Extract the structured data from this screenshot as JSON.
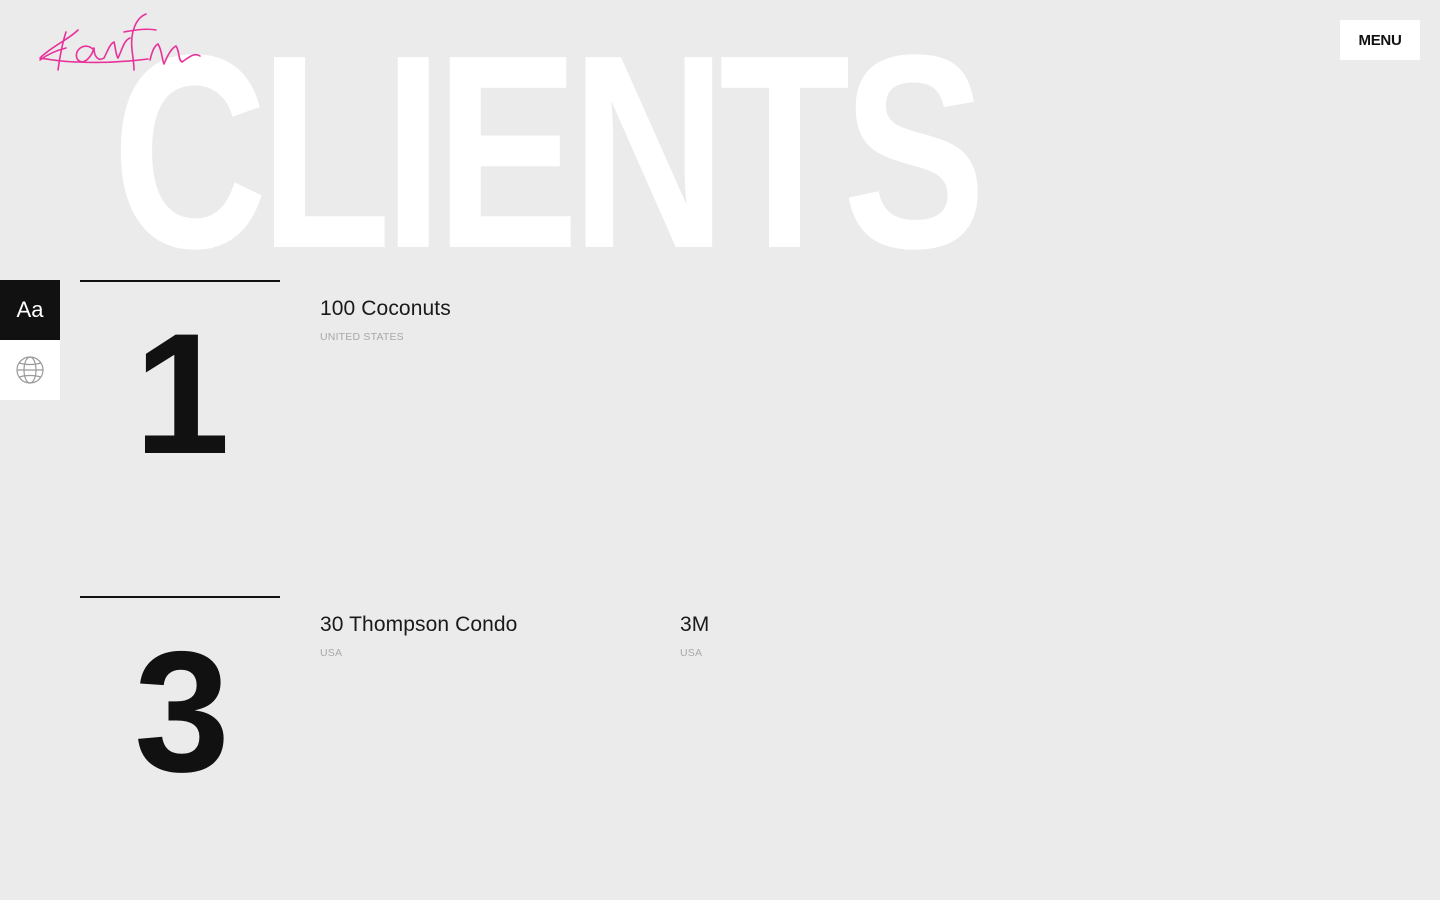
{
  "brand": {
    "logo_text": "Karim",
    "accent_color": "#e8329a"
  },
  "header": {
    "menu_label": "MENU"
  },
  "hero": {
    "title": "CLIENTS"
  },
  "tools": {
    "typeface_label": "Aa",
    "language_icon": "globe-icon"
  },
  "groups": [
    {
      "key": "1",
      "clients": [
        {
          "name": "100 Coconuts",
          "country": "UNITED STATES"
        }
      ]
    },
    {
      "key": "3",
      "clients": [
        {
          "name": "30 Thompson Condo",
          "country": "USA"
        },
        {
          "name": "3M",
          "country": "USA"
        }
      ]
    }
  ],
  "colors": {
    "background": "#ebebeb",
    "title": "#ffffff",
    "ink": "#111111",
    "muted": "#a8a8a8"
  }
}
